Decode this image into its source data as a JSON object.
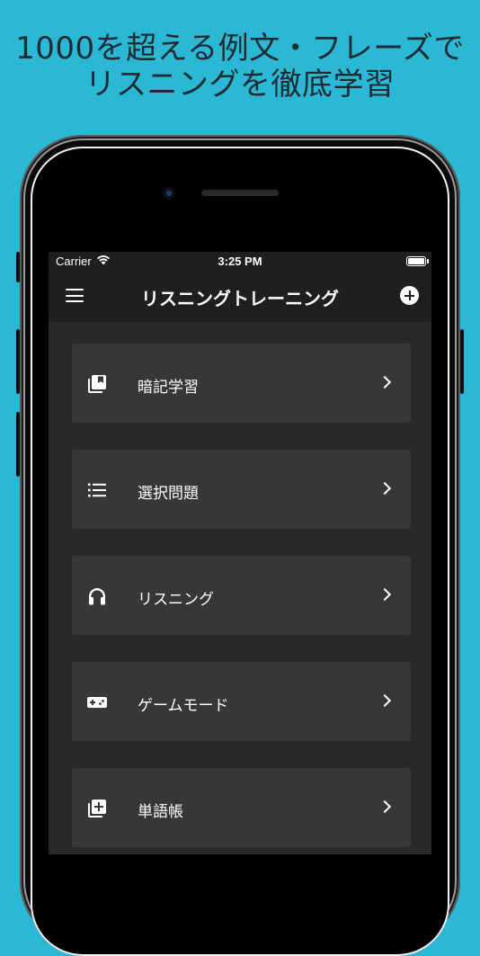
{
  "headline": {
    "line1": "1000を超える例文・フレーズで",
    "line2": "リスニングを徹底学習"
  },
  "status_bar": {
    "carrier": "Carrier",
    "time": "3:25 PM"
  },
  "nav": {
    "title": "リスニングトレーニング",
    "menu_icon": "hamburger-menu-icon",
    "add_icon": "add-circle-icon"
  },
  "menu_items": [
    {
      "label": "暗記学習",
      "icon": "flashcards-icon"
    },
    {
      "label": "選択問題",
      "icon": "list-icon"
    },
    {
      "label": "リスニング",
      "icon": "headphones-icon"
    },
    {
      "label": "ゲームモード",
      "icon": "gamepad-icon"
    },
    {
      "label": "単語帳",
      "icon": "add-to-library-icon"
    }
  ],
  "colors": {
    "background": "#2bb8d4",
    "screen": "#1f1f1f",
    "content": "#292929",
    "card": "#373737",
    "text": "#ffffff"
  }
}
